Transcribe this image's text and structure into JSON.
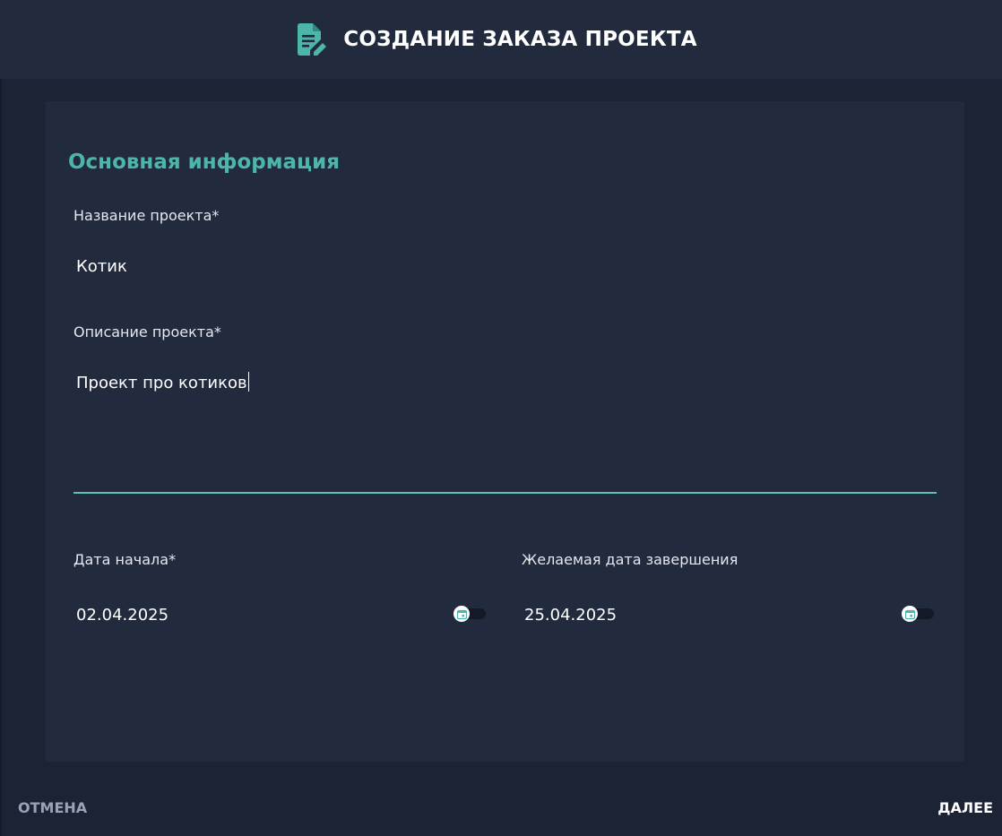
{
  "header": {
    "title": "СОЗДАНИЕ ЗАКАЗА ПРОЕКТА",
    "icon": "edit-document-icon"
  },
  "section": {
    "title": "Основная информация"
  },
  "fields": {
    "project_name": {
      "label": "Название проекта*",
      "value": "Котик"
    },
    "project_description": {
      "label": "Описание проекта*",
      "value": "Проект про котиков"
    },
    "start_date": {
      "label": "Дата начала*",
      "value": "02.04.2025",
      "icon": "calendar-icon"
    },
    "end_date": {
      "label": "Желаемая дата завершения",
      "value": "25.04.2025",
      "icon": "calendar-icon"
    }
  },
  "footer": {
    "cancel_label": "ОТМЕНА",
    "next_label": "ДАЛЕЕ"
  },
  "colors": {
    "background": "#1c2335",
    "panel": "#222a3e",
    "accent": "#4db6ac",
    "text": "#ffffff",
    "muted": "#9aa2b6"
  }
}
